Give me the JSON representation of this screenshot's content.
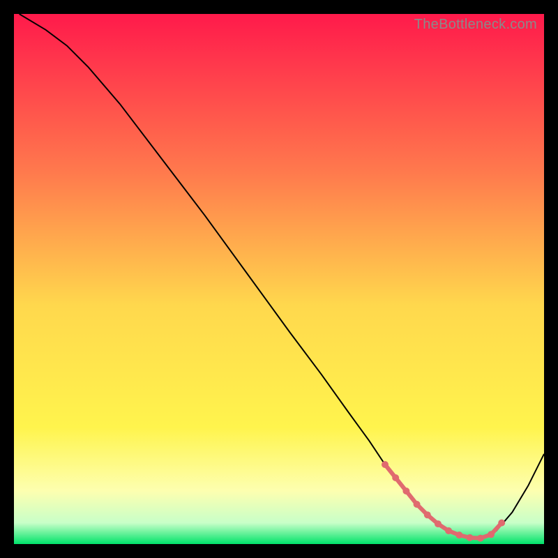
{
  "watermark": "TheBottleneck.com",
  "chart_data": {
    "type": "line",
    "title": "",
    "xlabel": "",
    "ylabel": "",
    "xlim": [
      0,
      100
    ],
    "ylim": [
      0,
      100
    ],
    "grid": false,
    "legend": false,
    "background_gradient": {
      "top": "#ff1a4b",
      "mid_upper": "#ff994d",
      "mid": "#ffe94d",
      "mid_lower": "#fffca8",
      "bottom": "#00e36a"
    },
    "series": [
      {
        "name": "curve",
        "color": "#000000",
        "x": [
          1,
          6,
          10,
          14,
          20,
          28,
          36,
          44,
          52,
          58,
          63,
          67,
          70,
          73,
          76,
          79,
          82,
          85,
          88,
          91,
          94,
          97,
          100
        ],
        "y": [
          100,
          97,
          94,
          90,
          83,
          72.5,
          62,
          51,
          40,
          32,
          25,
          19.5,
          15,
          11,
          7.5,
          4.5,
          2.5,
          1.3,
          1.1,
          2.5,
          6,
          11,
          17
        ]
      },
      {
        "name": "highlight-dots",
        "color": "#e06a6f",
        "type": "scatter",
        "x": [
          70,
          72,
          74,
          76,
          78,
          80,
          82,
          84,
          86,
          88,
          90,
          92
        ],
        "y": [
          15,
          12.5,
          10,
          7.5,
          5.5,
          3.8,
          2.5,
          1.7,
          1.2,
          1.1,
          1.8,
          4
        ]
      }
    ]
  }
}
